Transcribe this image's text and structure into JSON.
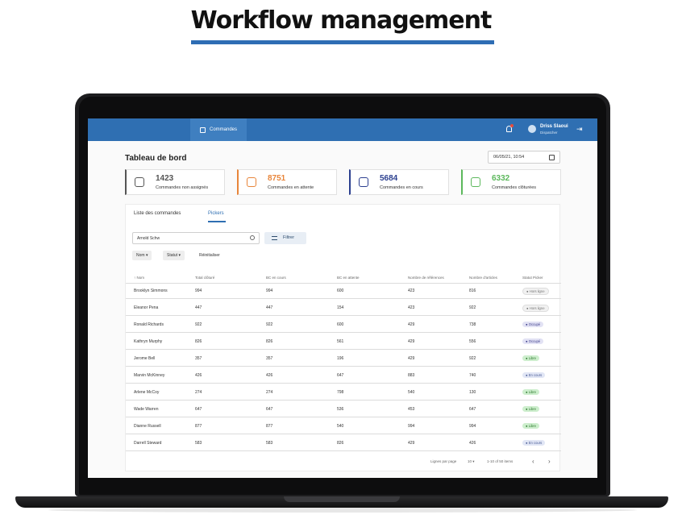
{
  "page_title": "Workflow management",
  "topbar": {
    "nav_label": "Commandes",
    "user_name": "Driss Slaoui",
    "user_role": "Dispatcher"
  },
  "header": {
    "title": "Tableau de bord",
    "date": "06/05/21, 10:54"
  },
  "stats": [
    {
      "value": "1423",
      "label": "Commandes non assignés",
      "color": "#555555"
    },
    {
      "value": "8751",
      "label": "Commandes en attente",
      "color": "#e8853a"
    },
    {
      "value": "5684",
      "label": "Commandes en cours",
      "color": "#2b3f8f"
    },
    {
      "value": "6332",
      "label": "Commandes clôturées",
      "color": "#5cb85c"
    }
  ],
  "tabs": [
    "Liste des commandes",
    "Pickers"
  ],
  "search": {
    "value": "Arnold Schw"
  },
  "filter_label": "Filtrer",
  "chips": [
    "Nom",
    "Statut"
  ],
  "reset_label": "Réinitialiser",
  "table": {
    "headers": [
      "Nom",
      "Total clôturé",
      "BC en cours",
      "BC en attente",
      "Nombre de références",
      "Nombre d'articles",
      "Statut Picker"
    ],
    "rows": [
      [
        "Brooklyn Simmons",
        "994",
        "994",
        "600",
        "423",
        "816",
        "Hors ligne"
      ],
      [
        "Eleanor Pena",
        "447",
        "447",
        "154",
        "423",
        "922",
        "Hors ligne"
      ],
      [
        "Ronald Richards",
        "922",
        "922",
        "600",
        "429",
        "738",
        "Occupé"
      ],
      [
        "Kathryn Murphy",
        "826",
        "826",
        "561",
        "429",
        "556",
        "Occupé"
      ],
      [
        "Jerome Bell",
        "357",
        "357",
        "196",
        "429",
        "922",
        "Libre"
      ],
      [
        "Marvin McKinney",
        "426",
        "426",
        "647",
        "883",
        "740",
        "En cours"
      ],
      [
        "Arlene McCoy",
        "274",
        "274",
        "798",
        "540",
        "130",
        "Libre"
      ],
      [
        "Wade Warren",
        "647",
        "647",
        "536",
        "453",
        "647",
        "Libre"
      ],
      [
        "Dianne Russell",
        "877",
        "877",
        "540",
        "994",
        "994",
        "Libre"
      ],
      [
        "Darrell Steward",
        "583",
        "583",
        "826",
        "429",
        "426",
        "En cours"
      ]
    ]
  },
  "footer": {
    "rows_label": "Lignes par page",
    "rows_value": "10",
    "range": "1-10 of 50 items"
  }
}
